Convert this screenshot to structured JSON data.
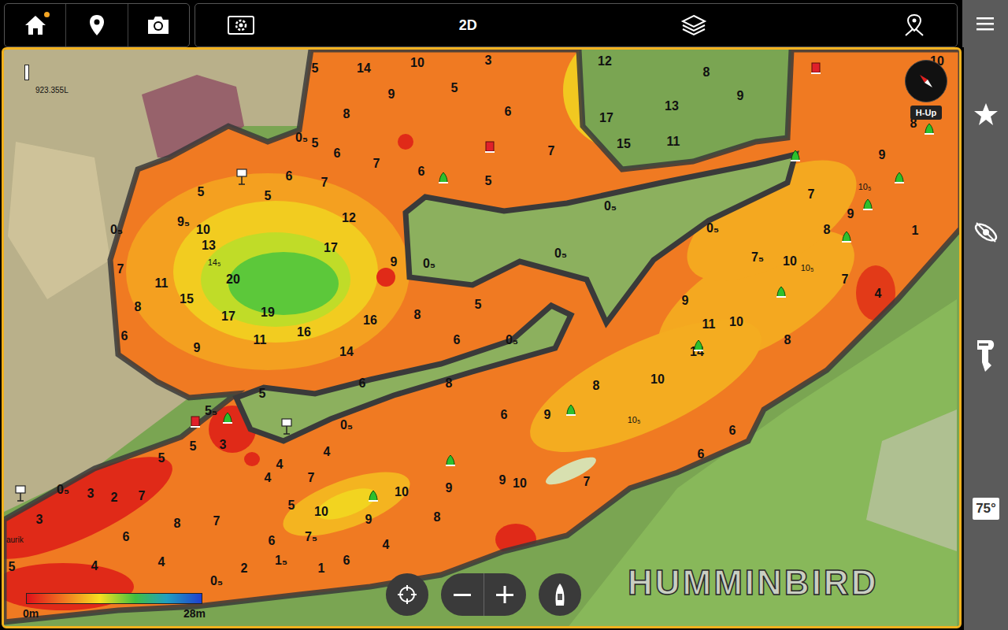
{
  "toolbar": {
    "home_notification": true,
    "view_mode": "2D"
  },
  "compass": {
    "label": "H-Up"
  },
  "map": {
    "coordinate_label": "923.355L",
    "place_label": "aurik",
    "depth_labels": [
      "5",
      "14",
      "10",
      "3",
      "9",
      "5",
      "8",
      "5",
      "6",
      "7",
      "6",
      "5",
      "6",
      "7",
      "12",
      "17",
      "15",
      "11",
      "13",
      "8",
      "9",
      "10",
      "8",
      "9",
      "10₅",
      "7",
      "9",
      "8",
      "7₅",
      "10",
      "10₅",
      "7",
      "9",
      "11",
      "10",
      "4",
      "8",
      "14",
      "6",
      "7",
      "5",
      "5",
      "9₅",
      "10",
      "13",
      "14₅",
      "7",
      "11",
      "8",
      "15",
      "20",
      "19",
      "17",
      "11",
      "16",
      "16",
      "14",
      "9",
      "6",
      "17",
      "12",
      "9",
      "8",
      "6",
      "6",
      "5",
      "8",
      "6",
      "9",
      "8",
      "10",
      "10₅",
      "6",
      "6",
      "7",
      "10",
      "9",
      "9",
      "8",
      "10",
      "9",
      "10",
      "4",
      "6",
      "7₅",
      "5",
      "4",
      "4",
      "7",
      "4",
      "3",
      "5",
      "5₅",
      "5",
      "7",
      "2",
      "3",
      "6",
      "8",
      "7",
      "6",
      "2",
      "1₅",
      "1",
      "4",
      "4",
      "5",
      "3",
      "5",
      "0₅",
      "0₅",
      "0₅",
      "0₅",
      "0₅",
      "0₅",
      "0₅",
      "0₅",
      "0₅",
      "0₅",
      "1"
    ],
    "markers": [
      {
        "kind": "buoy",
        "color": "#2dc02d"
      },
      {
        "kind": "buoy",
        "color": "#2dc02d"
      },
      {
        "kind": "buoy",
        "color": "#2dc02d"
      },
      {
        "kind": "buoy",
        "color": "#2dc02d"
      },
      {
        "kind": "buoy",
        "color": "#2dc02d"
      },
      {
        "kind": "buoy",
        "color": "#2dc02d"
      },
      {
        "kind": "buoy",
        "color": "#2dc02d"
      },
      {
        "kind": "buoy",
        "color": "#2dc02d"
      },
      {
        "kind": "buoy",
        "color": "#2dc02d"
      },
      {
        "kind": "buoy",
        "color": "#2dc02d"
      },
      {
        "kind": "buoy",
        "color": "#2dc02d"
      },
      {
        "kind": "buoy",
        "color": "#2dc02d"
      },
      {
        "kind": "can",
        "color": "#e0202a"
      },
      {
        "kind": "can",
        "color": "#e0202a"
      },
      {
        "kind": "can",
        "color": "#e0202a"
      },
      {
        "kind": "waypoint",
        "color": "#ffffff"
      },
      {
        "kind": "waypoint",
        "color": "#ffffff"
      },
      {
        "kind": "waypoint",
        "color": "#ffffff"
      }
    ]
  },
  "depth_scale": {
    "min": "0m",
    "max": "28m"
  },
  "sidebar": {
    "temperature": "75°"
  },
  "brand": "HUMMINBIRD"
}
